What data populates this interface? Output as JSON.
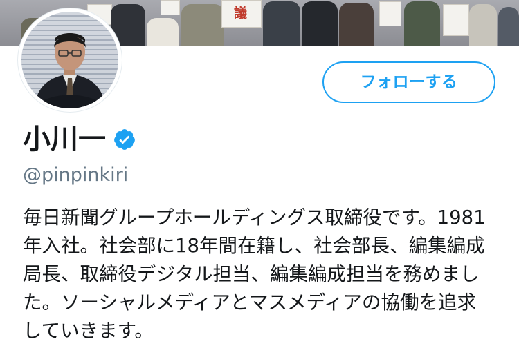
{
  "profile": {
    "display_name": "小川一",
    "handle": "@pinpinkiri",
    "verified": true,
    "bio": "毎日新聞グループホールディングス取締役です。1981\n年入社。社会部に18年間在籍し、社会部長、編集編成\n局長、取締役デジタル担当、編集編成担当を務めまし\nた。ソーシャルメディアとマスメディアの協働を追求\nしていきます。"
  },
  "actions": {
    "follow_label": "フォローする"
  },
  "banner": {
    "sign_text": "議"
  },
  "colors": {
    "accent": "#1da1f2",
    "handle_gray": "#657786",
    "text": "#14171a"
  },
  "icons": {
    "verified": "verified-badge-icon",
    "avatar": "profile-avatar"
  }
}
